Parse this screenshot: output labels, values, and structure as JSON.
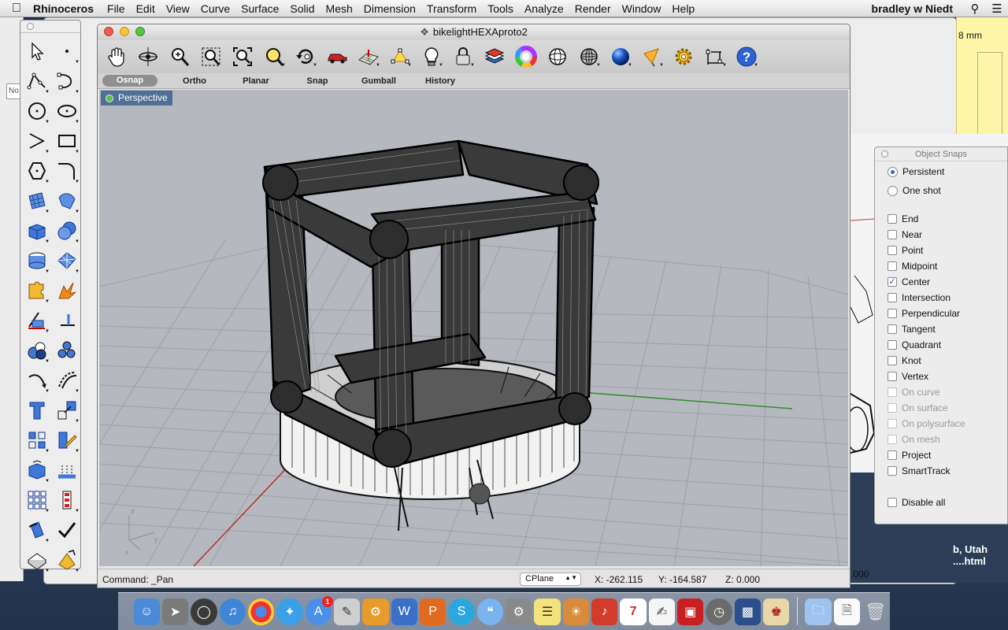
{
  "menubar": {
    "app_name": "Rhinoceros",
    "menus": [
      "File",
      "Edit",
      "View",
      "Curve",
      "Surface",
      "Solid",
      "Mesh",
      "Dimension",
      "Transform",
      "Tools",
      "Analyze",
      "Render",
      "Window",
      "Help"
    ],
    "user": "bradley w Niedt"
  },
  "window": {
    "title": "bikelightHEXAproto2"
  },
  "toolbar": {
    "icons": [
      "pan-hand-icon",
      "rotate-view-icon",
      "zoom-icon",
      "zoom-window-icon",
      "zoom-extents-icon",
      "zoom-selected-icon",
      "undo-view-icon",
      "named-view-car-icon",
      "grid-plane-icon",
      "select-points-icon",
      "light-bulb-icon",
      "lock-icon",
      "layers-icon",
      "color-wheel-icon",
      "wireframe-sphere-icon",
      "ghosted-sphere-icon",
      "rendered-sphere-icon",
      "draw-order-icon",
      "settings-gear-icon",
      "dimension-icon",
      "help-icon"
    ]
  },
  "modes": {
    "osnap": "Osnap",
    "ortho": "Ortho",
    "planar": "Planar",
    "snap": "Snap",
    "gumball": "Gumball",
    "history": "History"
  },
  "viewport": {
    "name": "Perspective",
    "axis_z": "z",
    "axis_y": "y",
    "axis_x": "x"
  },
  "status": {
    "command_label": "Command:",
    "command_value": "_Pan",
    "cplane": "CPlane",
    "x": "X: -262.115",
    "y": "Y: -164.587",
    "z": "Z: 0.000"
  },
  "osnap_panel": {
    "title": "Object Snaps",
    "mode_options": [
      {
        "label": "Persistent",
        "selected": true
      },
      {
        "label": "One shot",
        "selected": false
      }
    ],
    "snaps": [
      {
        "label": "End",
        "checked": false,
        "enabled": true
      },
      {
        "label": "Near",
        "checked": false,
        "enabled": true
      },
      {
        "label": "Point",
        "checked": false,
        "enabled": true
      },
      {
        "label": "Midpoint",
        "checked": false,
        "enabled": true
      },
      {
        "label": "Center",
        "checked": true,
        "enabled": true
      },
      {
        "label": "Intersection",
        "checked": false,
        "enabled": true
      },
      {
        "label": "Perpendicular",
        "checked": false,
        "enabled": true
      },
      {
        "label": "Tangent",
        "checked": false,
        "enabled": true
      },
      {
        "label": "Quadrant",
        "checked": false,
        "enabled": true
      },
      {
        "label": "Knot",
        "checked": false,
        "enabled": true
      },
      {
        "label": "Vertex",
        "checked": false,
        "enabled": true
      },
      {
        "label": "On curve",
        "checked": false,
        "enabled": false
      },
      {
        "label": "On surface",
        "checked": false,
        "enabled": false
      },
      {
        "label": "On polysurface",
        "checked": false,
        "enabled": false
      },
      {
        "label": "On mesh",
        "checked": false,
        "enabled": false
      },
      {
        "label": "Project",
        "checked": false,
        "enabled": true
      },
      {
        "label": "SmartTrack",
        "checked": false,
        "enabled": true
      }
    ],
    "disable_all": "Disable all"
  },
  "background": {
    "paper_text": "8 mm",
    "sketch_text_1": "b, Utah",
    "sketch_text_2": "....html",
    "sketch_number": ".000",
    "left_field": "No"
  },
  "dock": {
    "calendar_day": "7",
    "app_store_badge": "1"
  }
}
